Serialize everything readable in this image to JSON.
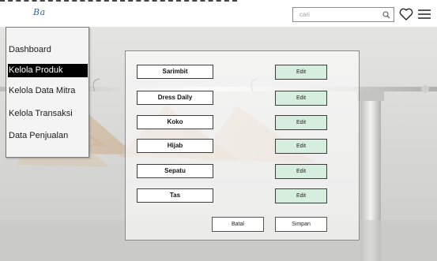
{
  "header": {
    "logo_text": "Ba",
    "search": {
      "placeholder": "cari",
      "value": ""
    },
    "icons": [
      "search-icon",
      "heart-icon",
      "menu-icon"
    ]
  },
  "sidebar": {
    "items": [
      {
        "label": "Dashboard",
        "active": false
      },
      {
        "label": "Kelola Produk",
        "active": true
      },
      {
        "label": "Kelola Data Mitra",
        "active": false
      },
      {
        "label": "Kelola Transaksi",
        "active": false
      },
      {
        "label": "Data Penjualan",
        "active": false
      }
    ]
  },
  "panel": {
    "categories": [
      {
        "name": "Sarimbit",
        "action": "Edit"
      },
      {
        "name": "Dress Daily",
        "action": "Edit"
      },
      {
        "name": "Koko",
        "action": "Edit"
      },
      {
        "name": "Hijab",
        "action": "Edit"
      },
      {
        "name": "Sepatu",
        "action": "Edit"
      },
      {
        "name": "Tas",
        "action": "Edit"
      }
    ],
    "cancel_label": "Batal",
    "save_label": "Simpan"
  },
  "colors": {
    "edit_button": "#d6eedd",
    "active_item_bg": "#000000",
    "logo": "#3a66a8"
  }
}
